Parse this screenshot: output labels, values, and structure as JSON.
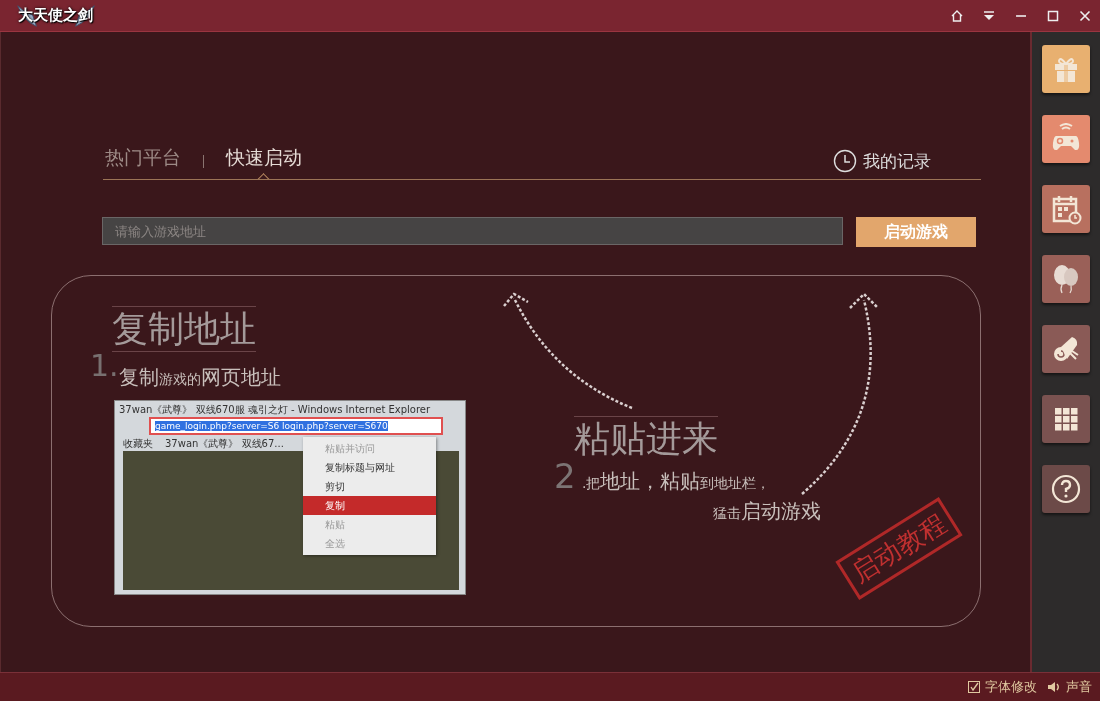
{
  "window": {
    "logo_text": "大天使之剑"
  },
  "tabs": [
    {
      "label": "热门平台",
      "selected": false
    },
    {
      "label": "快速启动",
      "selected": true
    }
  ],
  "history_link": "我的记录",
  "address": {
    "placeholder": "请输入游戏地址"
  },
  "launch_button": "启动游戏",
  "tutorial": {
    "step1": {
      "title": "复制地址",
      "number": "1.",
      "segments": [
        {
          "text": "复制",
          "emphasis": true
        },
        {
          "text": "游戏的",
          "emphasis": false
        },
        {
          "text": "网页地址",
          "emphasis": true
        }
      ]
    },
    "browser": {
      "title": "37wan《武尊》 双线670服 魂引之灯 - Windows Internet Explorer",
      "url": "game_login.php?server=S6 login.php?server=S670",
      "favorites": "收藏夹",
      "tab": "37wan《武尊》 双线67...",
      "menu": [
        {
          "label": "粘贴并访问",
          "disabled": true,
          "selected": false
        },
        {
          "label": "复制标题与网址",
          "disabled": false,
          "selected": false
        },
        {
          "label": "剪切",
          "disabled": false,
          "selected": false
        },
        {
          "label": "复制",
          "disabled": false,
          "selected": true
        },
        {
          "label": "粘贴",
          "disabled": true,
          "selected": false
        },
        {
          "label": "全选",
          "disabled": true,
          "selected": false
        }
      ]
    },
    "step2": {
      "title": "粘贴进来",
      "number": "2",
      "lines": [
        [
          {
            "text": ".",
            "emphasis": false
          },
          {
            "text": "把",
            "emphasis": false
          },
          {
            "text": "地址，粘贴",
            "emphasis": true
          },
          {
            "text": "到地址栏，",
            "emphasis": false
          }
        ],
        [
          {
            "text": "猛击",
            "emphasis": false
          },
          {
            "text": "启动游戏",
            "emphasis": true
          }
        ]
      ]
    },
    "stamp": "启动教程"
  },
  "sidebar": [
    {
      "kind": "gift",
      "color": "#e8b070"
    },
    {
      "kind": "gamepad",
      "color": "#e48a6e"
    },
    {
      "kind": "calendar",
      "color": "#b8705f"
    },
    {
      "kind": "balloons",
      "color": "#9a6058"
    },
    {
      "kind": "scroll",
      "color": "#8a5a56"
    },
    {
      "kind": "grid",
      "color": "#7a5250"
    },
    {
      "kind": "help",
      "color": "#6c4a48"
    }
  ],
  "status_bar": {
    "font_setting": {
      "label": "字体修改",
      "checked": true
    },
    "sound": {
      "label": "声音"
    }
  }
}
